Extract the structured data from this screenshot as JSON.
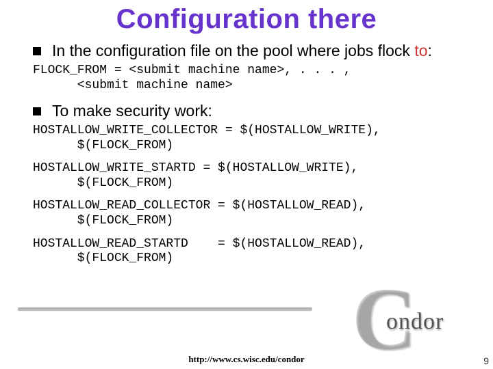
{
  "title": "Configuration there",
  "bullets": {
    "b1_pre": "In the configuration file on the pool where jobs flock ",
    "b1_accent": "to",
    "b1_post": ":",
    "b2": "To make security work:"
  },
  "code": {
    "c1": "FLOCK_FROM = <submit machine name>, . . . ,\n      <submit machine name>",
    "c2": "HOSTALLOW_WRITE_COLLECTOR = $(HOSTALLOW_WRITE),\n      $(FLOCK_FROM)",
    "c3": "HOSTALLOW_WRITE_STARTD = $(HOSTALLOW_WRITE),\n      $(FLOCK_FROM)",
    "c4": "HOSTALLOW_READ_COLLECTOR = $(HOSTALLOW_READ),\n      $(FLOCK_FROM)",
    "c5": "HOSTALLOW_READ_STARTD    = $(HOSTALLOW_READ),\n      $(FLOCK_FROM)"
  },
  "footer": "http://www.cs.wisc.edu/condor",
  "page_number": "9",
  "logo": {
    "c": "C",
    "word": "ondor"
  }
}
